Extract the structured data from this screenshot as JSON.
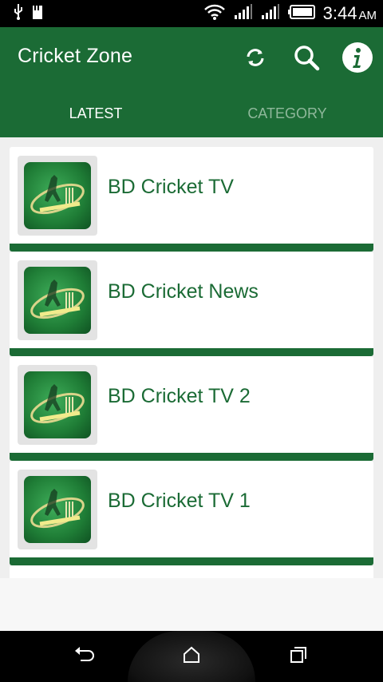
{
  "status_bar": {
    "time": "3:44",
    "ampm": "AM",
    "icons": [
      "usb-icon",
      "sd-card-icon",
      "wifi-icon",
      "signal-icon",
      "signal-icon",
      "battery-icon"
    ]
  },
  "app_bar": {
    "title": "Cricket Zone",
    "actions": [
      "refresh-icon",
      "search-icon",
      "info-icon"
    ],
    "color": "#1b6b35"
  },
  "tabs": [
    {
      "label": "LATEST",
      "active": true
    },
    {
      "label": "CATEGORY",
      "active": false
    }
  ],
  "channels": [
    {
      "label": "BD Cricket TV"
    },
    {
      "label": "BD Cricket News"
    },
    {
      "label": "BD Cricket TV 2"
    },
    {
      "label": "BD Cricket TV 1"
    }
  ],
  "nav_bar": {
    "buttons": [
      "back-icon",
      "home-icon",
      "recents-icon"
    ]
  }
}
